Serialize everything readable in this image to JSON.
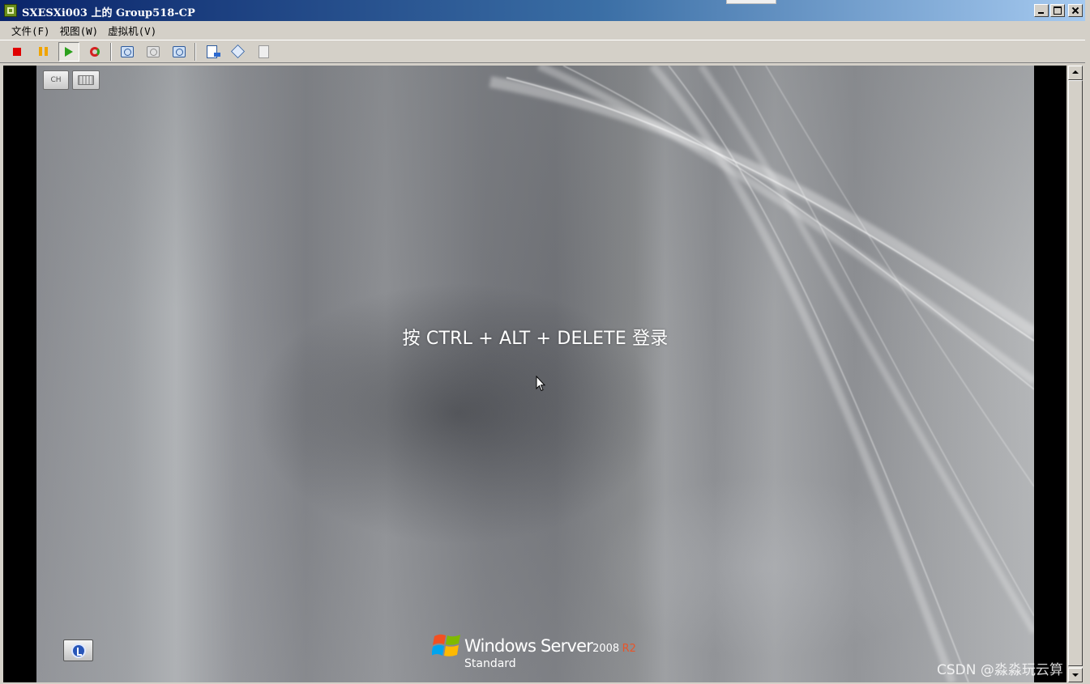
{
  "window": {
    "title": "SXESXi003 上的 Group518-CP",
    "app_icon": "vsphere-console-icon",
    "controls": [
      "minimize-icon",
      "maximize-icon",
      "close-icon"
    ]
  },
  "menu": {
    "items": [
      {
        "label": "文件(F)"
      },
      {
        "label": "视图(W)"
      },
      {
        "label": "虚拟机(V)"
      }
    ]
  },
  "toolbar": {
    "buttons": [
      {
        "icon": "power-off-icon",
        "state": "normal"
      },
      {
        "icon": "suspend-icon",
        "state": "normal"
      },
      {
        "icon": "power-on-icon",
        "state": "pressed"
      },
      {
        "icon": "reset-icon",
        "state": "normal"
      },
      {
        "icon": "take-snapshot-icon",
        "state": "normal"
      },
      {
        "icon": "revert-snapshot-icon",
        "state": "disabled"
      },
      {
        "icon": "snapshot-manager-icon",
        "state": "normal"
      },
      {
        "icon": "edit-settings-icon",
        "state": "normal"
      },
      {
        "icon": "vm-options-icon",
        "state": "normal"
      },
      {
        "icon": "connect-devices-icon",
        "state": "disabled"
      }
    ]
  },
  "vm_screen": {
    "language_indicator": "CH",
    "keyboard_icon": "keyboard-icon",
    "login_prompt": "按 CTRL + ALT + DELETE 登录",
    "accessibility_icon": "ease-of-access-icon",
    "brand": {
      "name": "Windows Server",
      "version": "2008",
      "release": "R2",
      "edition": "Standard"
    }
  },
  "watermark": "CSDN @淼淼玩云算",
  "colors": {
    "titlebar_start": "#0a246a",
    "titlebar_end": "#a6caf0",
    "chrome": "#d4d0c8",
    "stop_red": "#e00000",
    "pause_orange": "#f0a400",
    "play_green": "#2ca01c",
    "r2_accent": "#e8552a"
  }
}
